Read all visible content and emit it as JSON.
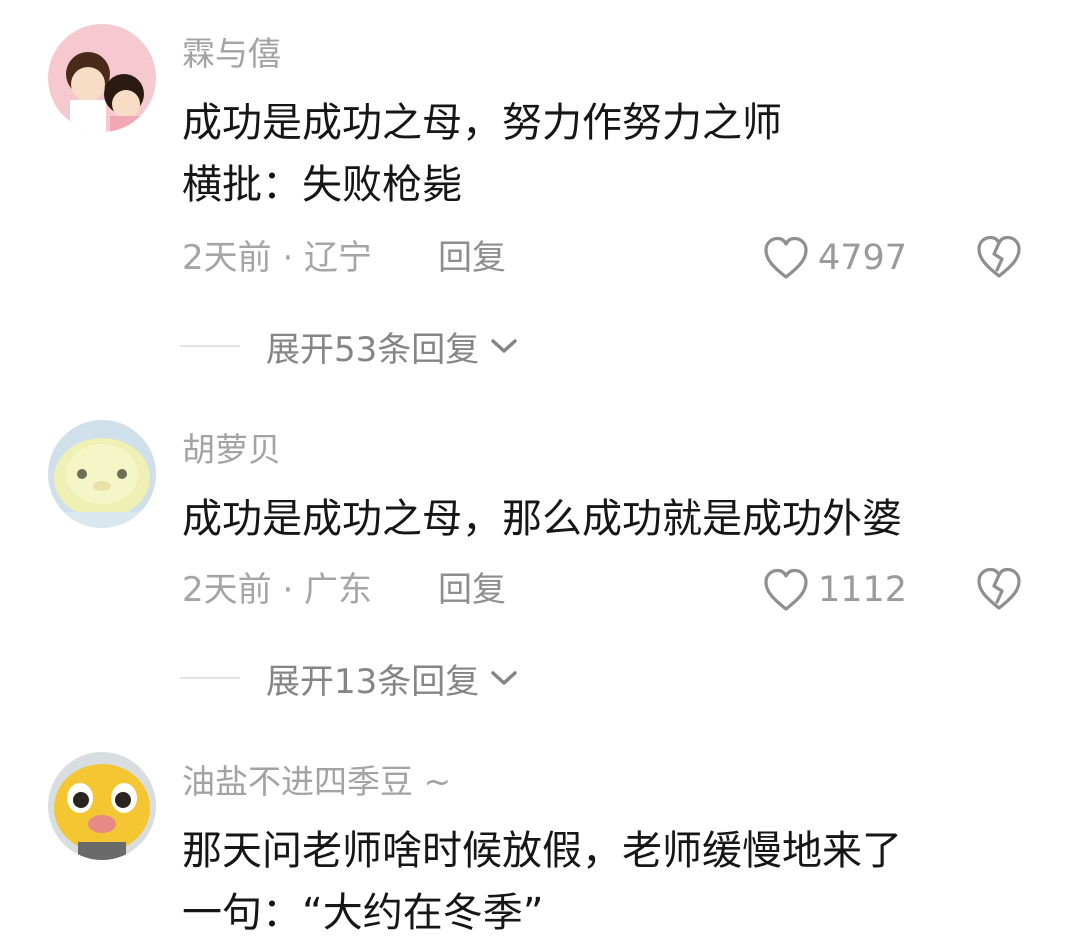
{
  "comments": [
    {
      "username": "霖与僖",
      "text_lines": [
        "成功是成功之母，努力作努力之师",
        "横批：失败枪毙"
      ],
      "time_location": "2天前 · 辽宁",
      "reply_label": "回复",
      "likes": "4797",
      "expand_label": "展开53条回复",
      "avatar": "cartoon-couple-avatar"
    },
    {
      "username": "胡萝贝",
      "text_lines": [
        "成功是成功之母，那么成功就是成功外婆"
      ],
      "time_location": "2天前 · 广东",
      "reply_label": "回复",
      "likes": "1112",
      "expand_label": "展开13条回复",
      "avatar": "yellow-chick-avatar"
    },
    {
      "username": "油盐不进四季豆 ~",
      "text_lines": [
        "那天问老师啥时候放假，老师缓慢地来了",
        "一句：“大约在冬季”"
      ],
      "avatar": "yellow-duck-face-avatar"
    }
  ],
  "icons": {
    "like": "heart-outline-icon",
    "dislike": "broken-heart-icon",
    "expand": "chevron-down-icon"
  },
  "colors": {
    "text": "#161616",
    "secondary": "#a3a3a3",
    "icon": "#9a9a9a"
  }
}
